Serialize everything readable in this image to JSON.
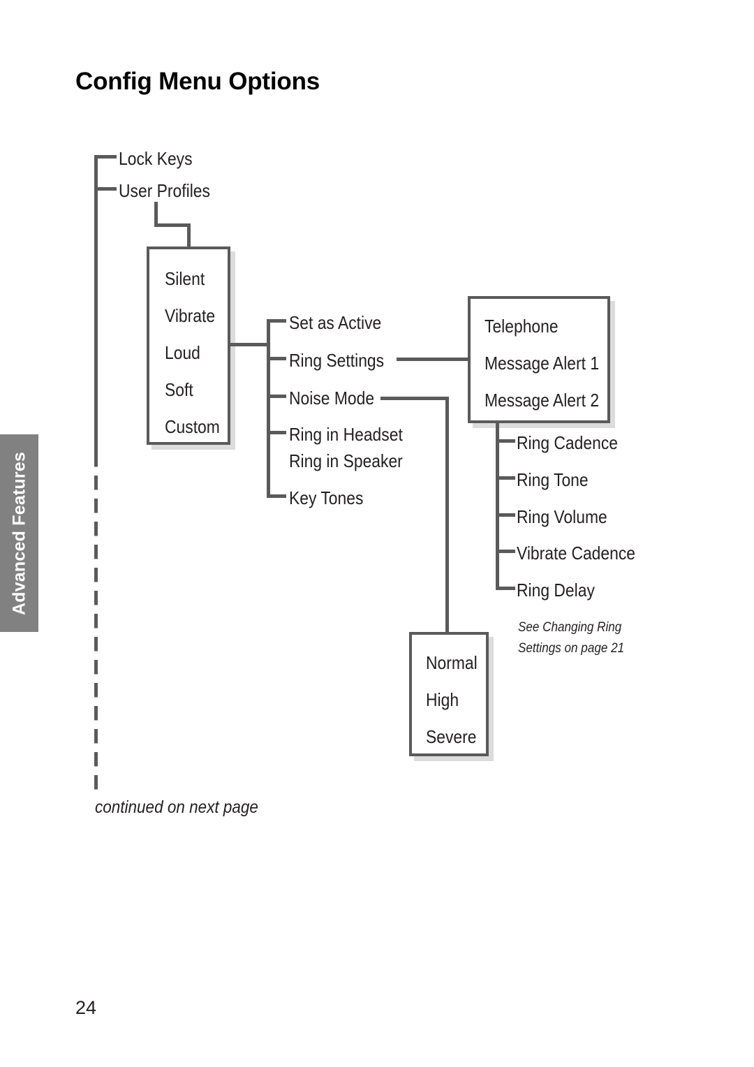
{
  "page": {
    "title": "Config Menu Options",
    "number": "24",
    "continued_note": "continued on next page"
  },
  "side_tab": {
    "label": "Advanced Features",
    "background_color": "#818181",
    "text_color": "#ffffff"
  },
  "colors": {
    "line": "#5a5a5a",
    "box_border": "#5a5a5a",
    "box_shadow": "#dcdcdc",
    "text": "#231f20",
    "background": "#ffffff"
  },
  "tree": {
    "root_branches": [
      {
        "label": "Lock Keys"
      },
      {
        "label": "User Profiles"
      }
    ],
    "profiles_box": {
      "items": [
        "Silent",
        "Vibrate",
        "Loud",
        "Soft",
        "Custom"
      ]
    },
    "profile_actions": [
      {
        "label": "Set as Active"
      },
      {
        "label": "Ring Settings"
      },
      {
        "label": "Noise Mode"
      },
      {
        "label": "Ring in Headset"
      },
      {
        "label": "Ring in Speaker"
      },
      {
        "label": "Key Tones"
      }
    ],
    "ring_targets_box": {
      "items": [
        "Telephone",
        "Message Alert 1",
        "Message Alert 2"
      ]
    },
    "ring_settings": [
      {
        "label": "Ring Cadence"
      },
      {
        "label": "Ring Tone"
      },
      {
        "label": "Ring Volume"
      },
      {
        "label": "Vibrate Cadence"
      },
      {
        "label": "Ring Delay"
      }
    ],
    "ring_settings_note": {
      "line1": "See Changing Ring",
      "line2": "Settings on page 21"
    },
    "noise_mode_box": {
      "items": [
        "Normal",
        "High",
        "Severe"
      ]
    }
  }
}
